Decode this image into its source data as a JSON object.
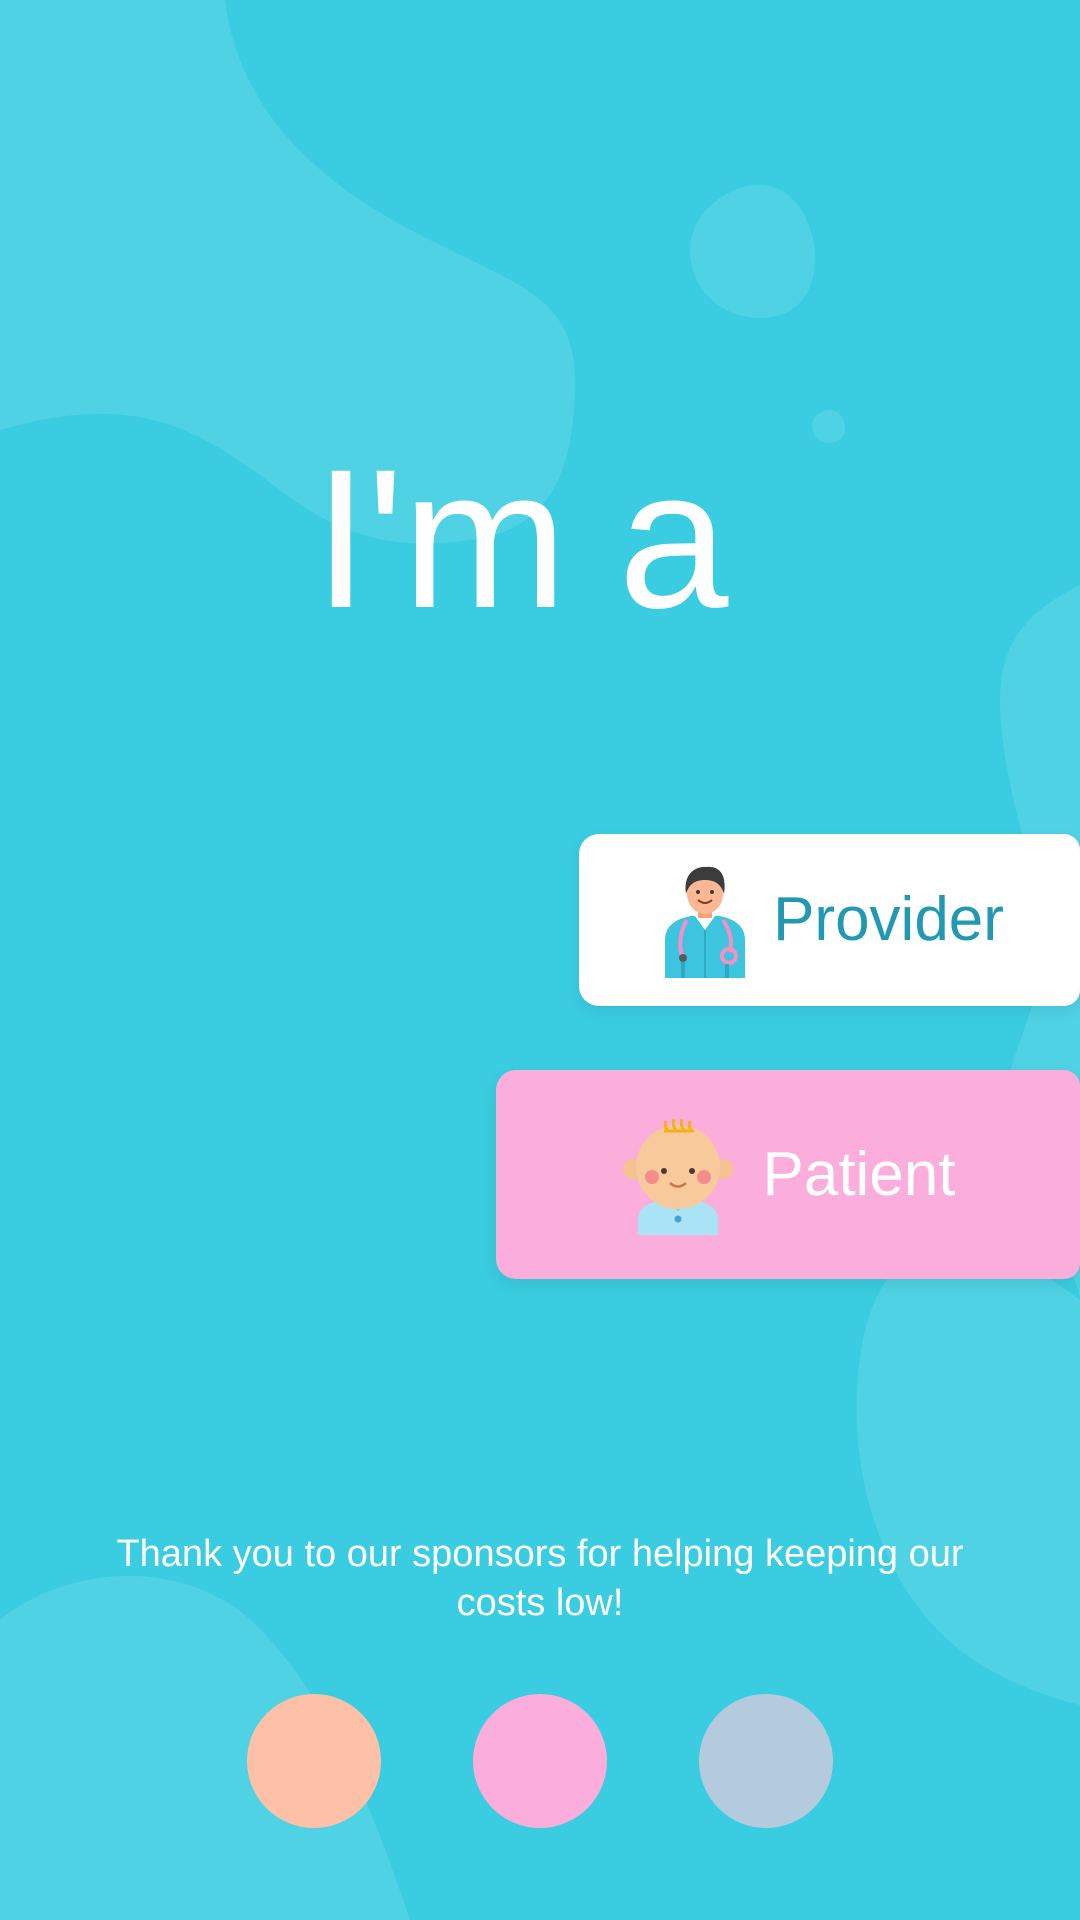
{
  "heading": "I'm a",
  "roles": {
    "provider": {
      "label": "Provider",
      "icon": "doctor-icon"
    },
    "patient": {
      "label": "Patient",
      "icon": "baby-icon"
    }
  },
  "sponsors": {
    "message": "Thank you to our sponsors for helping keeping our costs low!",
    "circles": [
      {
        "color": "#fec1a8"
      },
      {
        "color": "#fbaedb"
      },
      {
        "color": "#b4cbdd"
      }
    ]
  },
  "colors": {
    "background": "#3acce0",
    "blob": "#4fd2e4",
    "provider_button": "#ffffff",
    "provider_text": "#2298b3",
    "patient_button": "#fbaedb",
    "patient_text": "#ffffff"
  }
}
